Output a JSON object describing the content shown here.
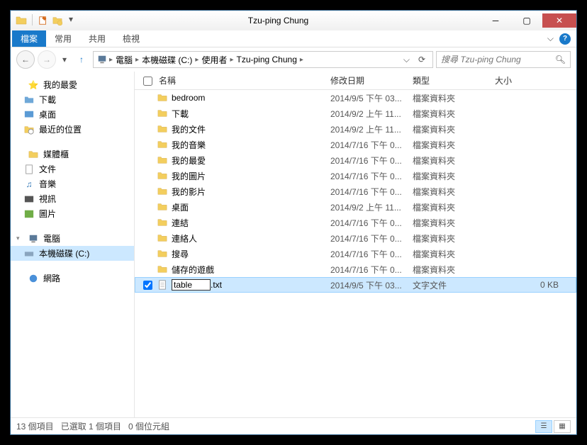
{
  "window": {
    "title": "Tzu-ping Chung"
  },
  "ribbon": {
    "file": "檔案",
    "tabs": [
      "常用",
      "共用",
      "檢視"
    ]
  },
  "breadcrumb": [
    "電腦",
    "本機磁碟 (C:)",
    "使用者",
    "Tzu-ping Chung"
  ],
  "search": {
    "placeholder": "搜尋 Tzu-ping Chung"
  },
  "columns": {
    "name": "名稱",
    "date": "修改日期",
    "type": "類型",
    "size": "大小"
  },
  "nav": {
    "favorites": {
      "label": "我的最愛",
      "items": [
        "下載",
        "桌面",
        "最近的位置"
      ]
    },
    "libraries": {
      "label": "媒體櫃",
      "items": [
        "文件",
        "音樂",
        "視訊",
        "圖片"
      ]
    },
    "computer": {
      "label": "電腦",
      "items": [
        "本機磁碟 (C:)"
      ]
    },
    "network": {
      "label": "網路"
    }
  },
  "files": [
    {
      "name": "bedroom",
      "date": "2014/9/5 下午 03...",
      "type": "檔案資料夾",
      "size": ""
    },
    {
      "name": "下載",
      "date": "2014/9/2 上午 11...",
      "type": "檔案資料夾",
      "size": ""
    },
    {
      "name": "我的文件",
      "date": "2014/9/2 上午 11...",
      "type": "檔案資料夾",
      "size": ""
    },
    {
      "name": "我的音樂",
      "date": "2014/7/16 下午 0...",
      "type": "檔案資料夾",
      "size": ""
    },
    {
      "name": "我的最愛",
      "date": "2014/7/16 下午 0...",
      "type": "檔案資料夾",
      "size": ""
    },
    {
      "name": "我的圖片",
      "date": "2014/7/16 下午 0...",
      "type": "檔案資料夾",
      "size": ""
    },
    {
      "name": "我的影片",
      "date": "2014/7/16 下午 0...",
      "type": "檔案資料夾",
      "size": ""
    },
    {
      "name": "桌面",
      "date": "2014/9/2 上午 11...",
      "type": "檔案資料夾",
      "size": ""
    },
    {
      "name": "連結",
      "date": "2014/7/16 下午 0...",
      "type": "檔案資料夾",
      "size": ""
    },
    {
      "name": "連絡人",
      "date": "2014/7/16 下午 0...",
      "type": "檔案資料夾",
      "size": ""
    },
    {
      "name": "搜尋",
      "date": "2014/7/16 下午 0...",
      "type": "檔案資料夾",
      "size": ""
    },
    {
      "name": "儲存的遊戲",
      "date": "2014/7/16 下午 0...",
      "type": "檔案資料夾",
      "size": ""
    }
  ],
  "editing_file": {
    "name": "table",
    "ext": ".txt",
    "date": "2014/9/5 下午 03...",
    "type": "文字文件",
    "size": "0 KB"
  },
  "status": {
    "count": "13 個項目",
    "selected": "已選取 1 個項目",
    "size": "0 個位元組"
  }
}
